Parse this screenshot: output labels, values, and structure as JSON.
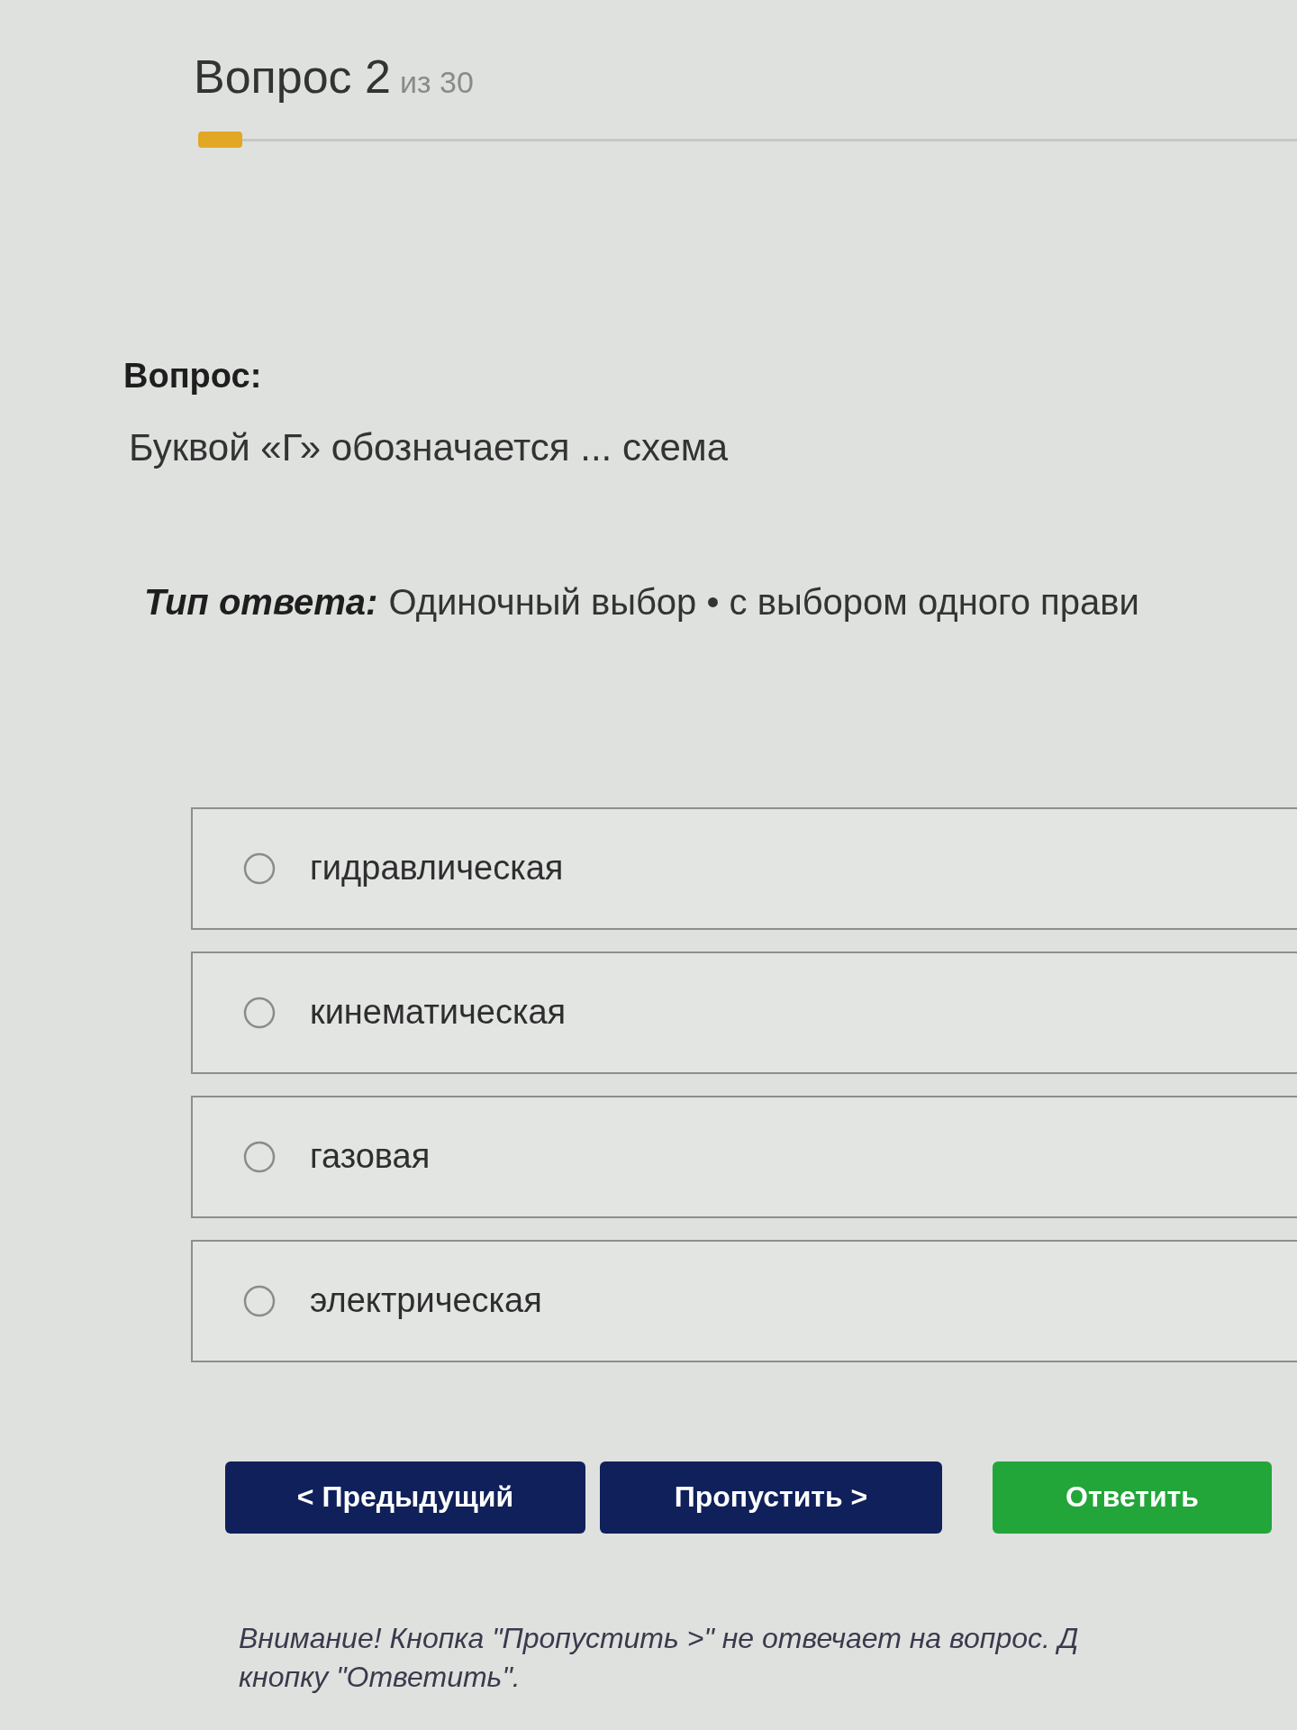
{
  "header": {
    "title": "Вопрос 2",
    "total": "из 30"
  },
  "progress": {
    "level": 0.04
  },
  "question": {
    "label": "Вопрос:",
    "text": "Буквой «Г» обозначается ... схема"
  },
  "answer_type": {
    "label": "Тип ответа:",
    "value": "Одиночный выбор • с выбором одного прави"
  },
  "options": [
    {
      "label": "гидравлическая",
      "selected": false
    },
    {
      "label": "кинематическая",
      "selected": false
    },
    {
      "label": "газовая",
      "selected": false
    },
    {
      "label": "электрическая",
      "selected": false
    }
  ],
  "buttons": [
    {
      "label": "< Предыдущий",
      "kind": "nav"
    },
    {
      "label": "Пропустить >",
      "kind": "nav"
    },
    {
      "label": "Ответить",
      "kind": "submit"
    }
  ],
  "note": {
    "lines": [
      "Внимание! Кнопка \"Пропустить >\" не отвечает на вопрос. Д",
      "кнопку \"Ответить\"."
    ]
  }
}
